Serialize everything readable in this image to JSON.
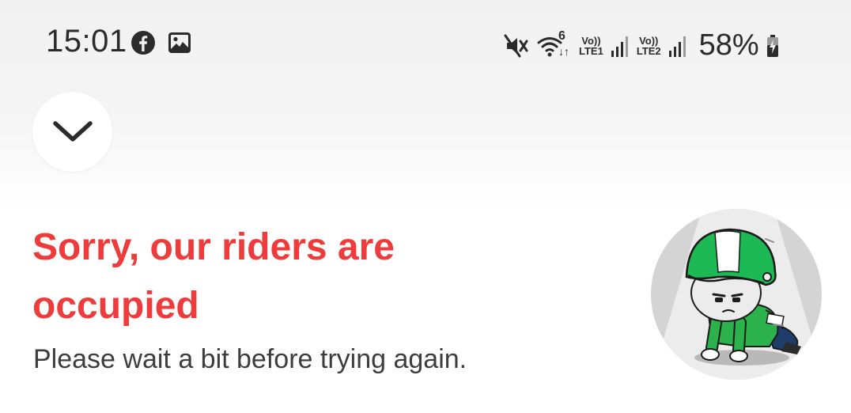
{
  "status_bar": {
    "time": "15:01",
    "left_icons": [
      "facebook-icon",
      "gallery-icon"
    ],
    "right_icons": [
      "mute-icon",
      "wifi-icon",
      "signal-icon",
      "signal-icon"
    ],
    "wifi_generation": "6",
    "sim1_label_top": "Vo))",
    "sim1_label_bottom": "LTE1",
    "sim2_label_top": "Vo))",
    "sim2_label_bottom": "LTE2",
    "battery_percent": "58%",
    "battery_icon": "battery-charging-icon"
  },
  "collapse_button": {
    "icon": "chevron-down-icon"
  },
  "message": {
    "title": "Sorry, our riders are occupied",
    "subtitle": "Please wait a bit before trying again."
  },
  "illustration": {
    "icon": "sad-rider-illustration",
    "helmet_color": "#1db954",
    "accent_color": "#ee3b3b"
  }
}
